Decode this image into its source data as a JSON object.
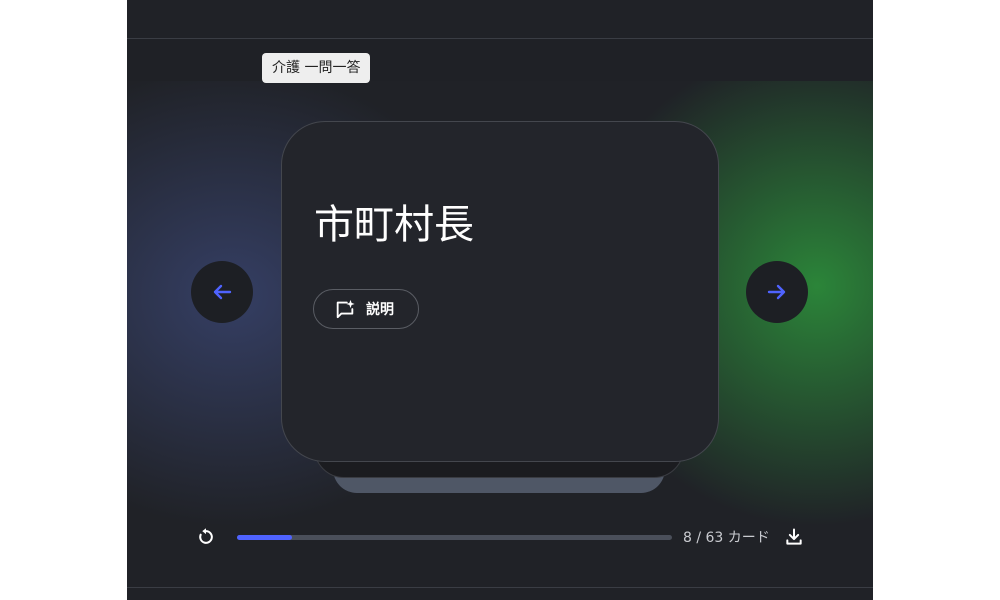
{
  "tooltip": {
    "text": "介護 一問一答"
  },
  "card": {
    "term": "市町村長",
    "explain_label": "説明"
  },
  "icons": {
    "prev": "arrow-left-icon",
    "next": "arrow-right-icon",
    "explain": "sparkle-comment-icon",
    "restart": "restart-icon",
    "download": "download-icon"
  },
  "progress": {
    "current": 8,
    "total": 63,
    "fraction": 0.127,
    "label": "8 / 63 カード"
  },
  "colors": {
    "accent": "#4f63ff",
    "background": "#202227",
    "card": "#23252b",
    "glow_left": "#465696",
    "glow_right": "#2d963c"
  }
}
